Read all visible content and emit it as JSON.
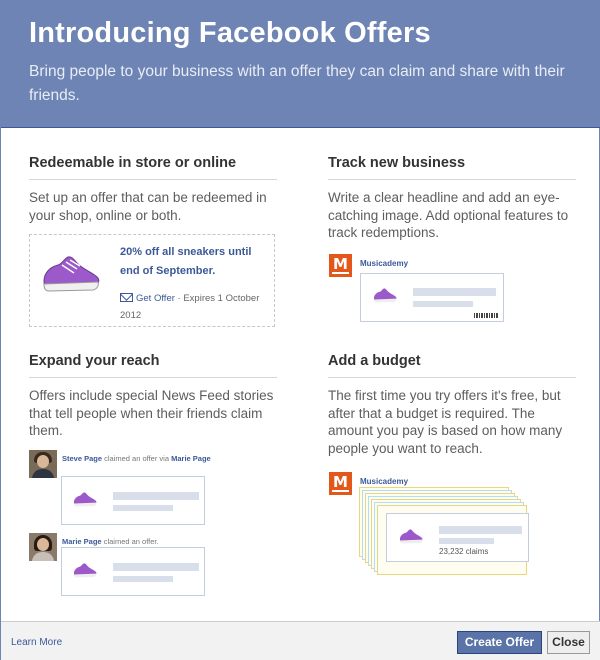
{
  "header": {
    "title": "Introducing Facebook Offers",
    "subtitle": "Bring people to your business with an offer they can claim and share with their friends."
  },
  "sections": {
    "redeem": {
      "title": "Redeemable in store or online",
      "description": "Set up an offer that can be redeemed in your shop, online or both.",
      "offer_title": "20% off all sneakers until end of September.",
      "get_offer_label": "Get Offer",
      "expires": " · Expires 1 October 2012"
    },
    "track": {
      "title": "Track new business",
      "description": "Write a clear headline and add an eye-catching image. Add optional features to track redemptions.",
      "page_name": "Musicademy"
    },
    "reach": {
      "title": "Expand your reach",
      "description": "Offers include special News Feed stories that tell people when their friends claim them.",
      "story1_name": "Steve Page",
      "story1_text": " claimed an offer via ",
      "story1_page": "Marie Page",
      "story2_name": "Marie Page",
      "story2_text": " claimed an offer."
    },
    "budget": {
      "title": "Add a budget",
      "description": "The first time you try offers it's free, but after that a budget is required. The amount you pay is based on how many people you want to reach.",
      "page_name": "Musicademy",
      "claims": "23,232 claims"
    }
  },
  "footer": {
    "learn_more": "Learn More",
    "create_offer": "Create Offer",
    "close": "Close"
  },
  "icons": {
    "shoe": "sneaker-icon",
    "envelope": "envelope-icon",
    "logo": "musicademy-logo"
  },
  "colors": {
    "header": "#6d84b4",
    "link": "#3b5998",
    "primary_button": "#5b74a8",
    "shoe": "#9b59c9"
  }
}
